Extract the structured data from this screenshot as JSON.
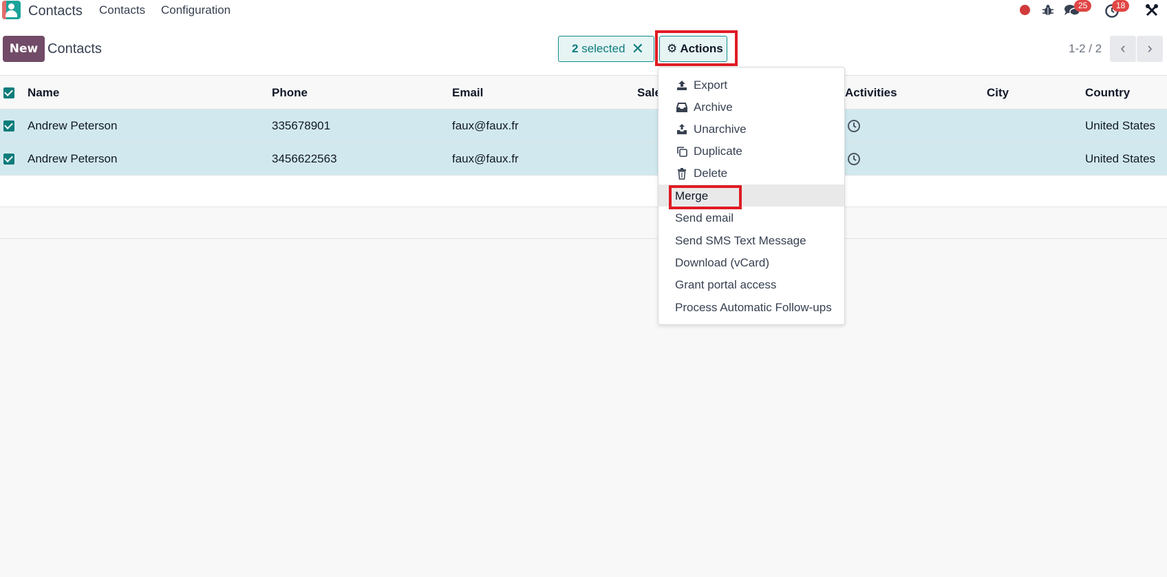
{
  "topbar": {
    "app_title": "Contacts",
    "nav": [
      "Contacts",
      "Configuration"
    ],
    "messages_count": "25",
    "activities_count": "18"
  },
  "control": {
    "new_label": "New",
    "breadcrumb": "Contacts",
    "selected_count": "2",
    "selected_label": "selected",
    "actions_label": "Actions",
    "pager": "1-2 / 2"
  },
  "table": {
    "columns": [
      "Name",
      "Phone",
      "Email",
      "Sale",
      "Activities",
      "City",
      "Country"
    ],
    "rows": [
      {
        "name": "Andrew Peterson",
        "phone": "335678901",
        "email": "faux@faux.fr",
        "city": "",
        "country": "United States"
      },
      {
        "name": "Andrew Peterson",
        "phone": "3456622563",
        "email": "faux@faux.fr",
        "city": "",
        "country": "United States"
      }
    ]
  },
  "actions_menu": {
    "items": [
      "Export",
      "Archive",
      "Unarchive",
      "Duplicate",
      "Delete",
      "Merge",
      "Send email",
      "Send SMS Text Message",
      "Download (vCard)",
      "Grant portal access",
      "Process Automatic Follow-ups"
    ]
  },
  "colors": {
    "brand": "#714b67",
    "accent": "#0f7c7c",
    "selected_row": "#d1e9ee",
    "highlight": "#e01b24"
  }
}
